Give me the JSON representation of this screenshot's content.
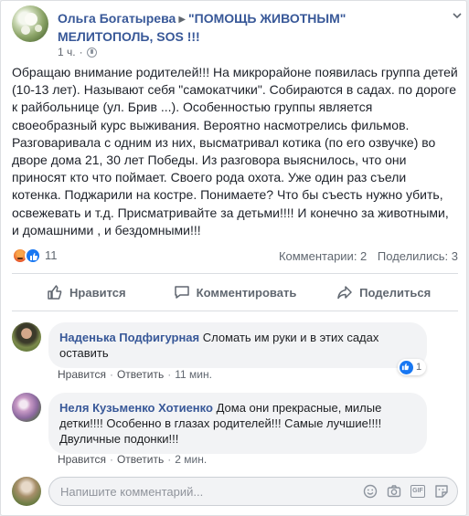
{
  "post": {
    "author": "Ольга Богатырева",
    "group": "\"ПОМОЩЬ ЖИВОТНЫМ\" МЕЛИТОПОЛЬ, SOS !!!",
    "time": "1 ч.",
    "text": "Обращаю внимание родителей!!! На микрорайоне появилась группа детей (10-13 лет). Называют себя \"самокатчики\". Собираются в садах. по дороге к райбольнице (ул. Брив ...). Особенностью группы является своеобразный курс выживания. Вероятно насмотрелись фильмов. Разговаривала с одним из них, высматривал котика (по его озвучке) во дворе дома 21, 30 лет Победы. Из разговора выяснилось, что они приносят кто что поймает. Своего рода охота. Уже один раз съели котенка. Поджарили на костре. Понимаете? Что бы съесть нужно убить, освежевать и т.д. Присматривайте за детьми!!!! И конечно за животными, и домашними , и бездомными!!!",
    "reaction_count": "11",
    "comments_count": "Комментарии: 2",
    "shares_count": "Поделились: 3"
  },
  "actions": {
    "like": "Нравится",
    "comment": "Комментировать",
    "share": "Поделиться"
  },
  "comments": [
    {
      "author": "Наденька Подфигурная",
      "text": "Сломать им руки и в этих садах оставить",
      "like": "Нравится",
      "reply": "Ответить",
      "time": "11 мин.",
      "likes": "1"
    },
    {
      "author": "Неля Кузьменко Хотиенко",
      "text": "Дома они прекрасные, милые детки!!!! Особенно в глазах родителей!!! Самые лучшие!!!! Двуличные подонки!!!",
      "like": "Нравится",
      "reply": "Ответить",
      "time": "2 мин."
    }
  ],
  "composer": {
    "placeholder": "Напишите комментарий..."
  },
  "icons": {
    "top_right": "chevron-down-icon",
    "privacy": "globe-icon",
    "like": "thumbs-up-icon",
    "comment": "speech-bubble-icon",
    "share": "share-arrow-icon",
    "emoji": "smiley-icon",
    "camera": "camera-icon",
    "gif": "gif-icon",
    "sticker": "sticker-icon"
  },
  "colors": {
    "link": "#385898",
    "like_blue": "#1877f2",
    "muted": "#606770",
    "bubble": "#f2f3f5"
  }
}
